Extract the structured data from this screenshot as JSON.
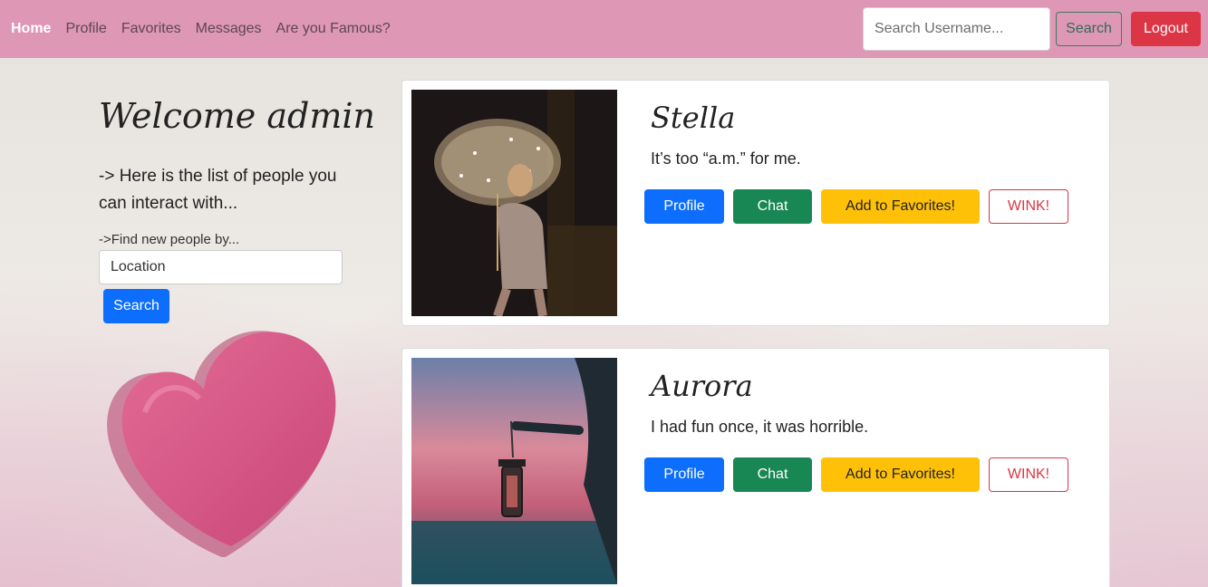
{
  "nav": {
    "items": [
      {
        "label": "Home",
        "active": true
      },
      {
        "label": "Profile",
        "active": false
      },
      {
        "label": "Favorites",
        "active": false
      },
      {
        "label": "Messages",
        "active": false
      },
      {
        "label": "Are you Famous?",
        "active": false
      }
    ],
    "search_placeholder": "Search Username...",
    "search_label": "Search",
    "logout_label": "Logout"
  },
  "sidebar": {
    "welcome": "Welcome admin",
    "intro": "-> Here is the list of people you can interact with...",
    "find_label": "->Find new people by...",
    "location_value": "Location",
    "search_label": "Search"
  },
  "cards": [
    {
      "name": "Stella",
      "bio": "It’s too “a.m.” for me.",
      "actions": {
        "profile": "Profile",
        "chat": "Chat",
        "favorites": "Add to Favorites!",
        "wink": "WINK!"
      }
    },
    {
      "name": "Aurora",
      "bio": "I had fun once, it was horrible.",
      "actions": {
        "profile": "Profile",
        "chat": "Chat",
        "favorites": "Add to Favorites!",
        "wink": "WINK!"
      }
    }
  ],
  "colors": {
    "navbar": "#de97b4",
    "primary": "#0d6efd",
    "success": "#198754",
    "warning": "#ffc107",
    "danger": "#dc3545"
  }
}
